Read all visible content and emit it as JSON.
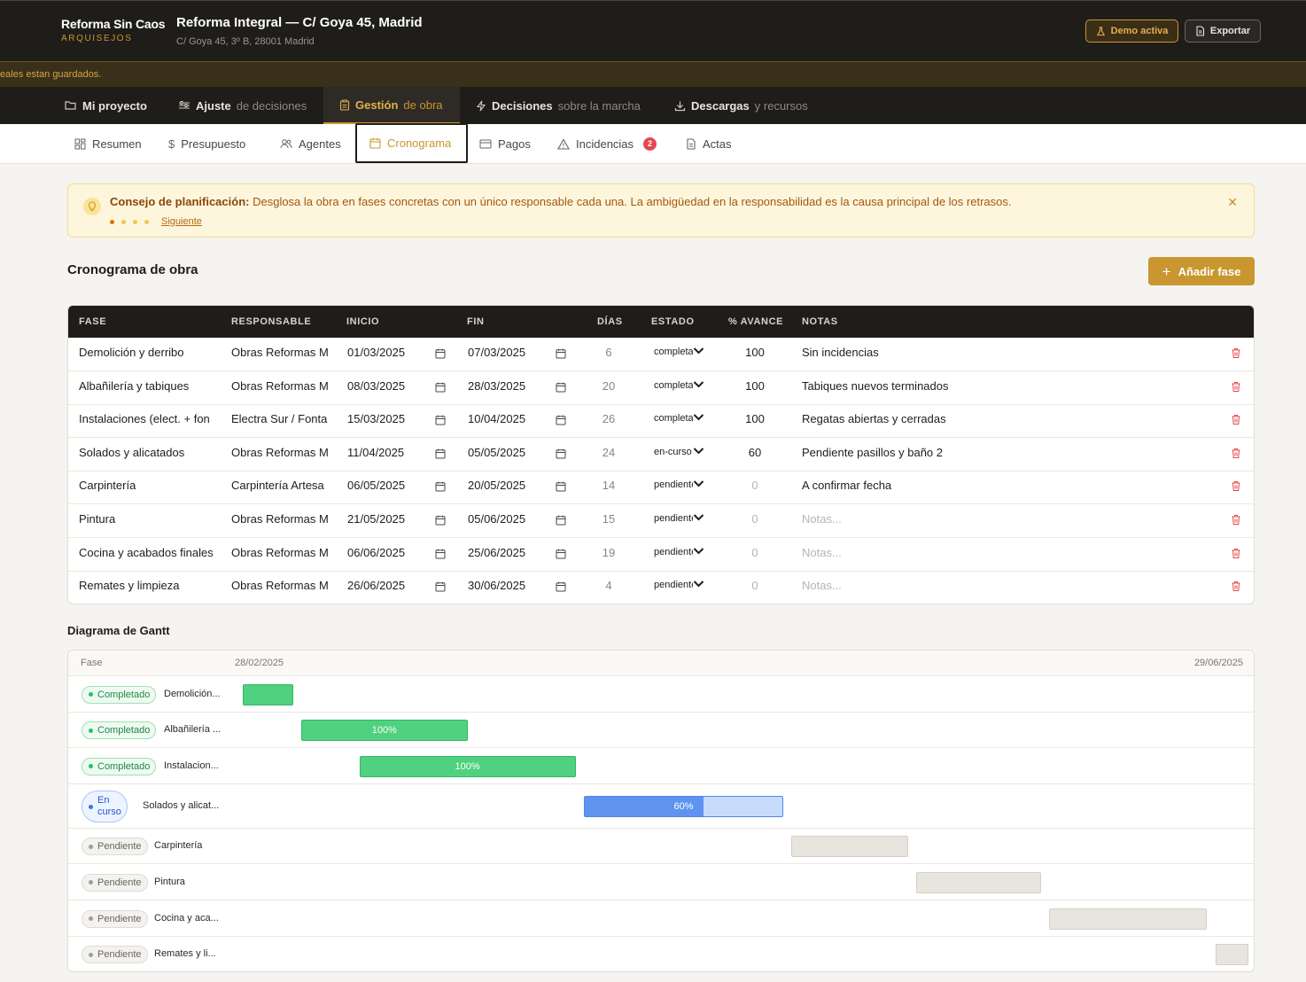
{
  "header": {
    "brand_name": "Reforma Sin Caos",
    "brand_sub": "ARQUISEJOS",
    "project_title": "Reforma Integral — C/ Goya 45, Madrid",
    "project_address": "C/ Goya 45, 3º B, 28001 Madrid",
    "demo_label": "Demo activa",
    "export_label": "Exportar"
  },
  "save_notice": "eales estan guardados.",
  "main_nav": [
    {
      "bold": "Mi proyecto",
      "light": ""
    },
    {
      "bold": "Ajuste",
      "light": "de decisiones"
    },
    {
      "bold": "Gestión",
      "light": "de obra"
    },
    {
      "bold": "Decisiones",
      "light": "sobre la marcha"
    },
    {
      "bold": "Descargas",
      "light": "y recursos"
    }
  ],
  "sub_nav": [
    {
      "label": "Resumen"
    },
    {
      "label": "Presupuesto"
    },
    {
      "label": "Agentes"
    },
    {
      "label": "Cronograma"
    },
    {
      "label": "Pagos"
    },
    {
      "label": "Incidencias",
      "badge": "2"
    },
    {
      "label": "Actas"
    }
  ],
  "tip": {
    "title": "Consejo de planificación:",
    "text": "Desglosa la obra en fases concretas con un único responsable cada una. La ambigüedad en la responsabilidad es la causa principal de los retrasos.",
    "next_label": "Siguiente"
  },
  "schedule": {
    "title": "Cronograma de obra",
    "add_label": "Añadir fase",
    "columns": [
      "FASE",
      "RESPONSABLE",
      "INICIO",
      "FIN",
      "DÍAS",
      "ESTADO",
      "% AVANCE",
      "NOTAS"
    ],
    "rows": [
      {
        "fase": "Demolición y derribo",
        "resp": "Obras Reformas M",
        "inicio": "01/03/2025",
        "fin": "07/03/2025",
        "dias": "6",
        "estado": "completado",
        "avance": "100",
        "notas": "Sin incidencias"
      },
      {
        "fase": "Albañilería y tabiques",
        "resp": "Obras Reformas M",
        "inicio": "08/03/2025",
        "fin": "28/03/2025",
        "dias": "20",
        "estado": "completado",
        "avance": "100",
        "notas": "Tabiques nuevos terminados"
      },
      {
        "fase": "Instalaciones (elect. + fon",
        "resp": "Electra Sur / Fonta",
        "inicio": "15/03/2025",
        "fin": "10/04/2025",
        "dias": "26",
        "estado": "completado",
        "avance": "100",
        "notas": "Regatas abiertas y cerradas"
      },
      {
        "fase": "Solados y alicatados",
        "resp": "Obras Reformas M",
        "inicio": "11/04/2025",
        "fin": "05/05/2025",
        "dias": "24",
        "estado": "en-curso",
        "avance": "60",
        "notas": "Pendiente pasillos y baño 2"
      },
      {
        "fase": "Carpintería",
        "resp": "Carpintería Artesa",
        "inicio": "06/05/2025",
        "fin": "20/05/2025",
        "dias": "14",
        "estado": "pendiente",
        "avance": "0",
        "notas": "A confirmar fecha"
      },
      {
        "fase": "Pintura",
        "resp": "Obras Reformas M",
        "inicio": "21/05/2025",
        "fin": "05/06/2025",
        "dias": "15",
        "estado": "pendiente",
        "avance": "0",
        "notas": ""
      },
      {
        "fase": "Cocina y acabados finales",
        "resp": "Obras Reformas M",
        "inicio": "06/06/2025",
        "fin": "25/06/2025",
        "dias": "19",
        "estado": "pendiente",
        "avance": "0",
        "notas": ""
      },
      {
        "fase": "Remates y limpieza",
        "resp": "Obras Reformas M",
        "inicio": "26/06/2025",
        "fin": "30/06/2025",
        "dias": "4",
        "estado": "pendiente",
        "avance": "0",
        "notas": ""
      }
    ],
    "notes_placeholder": "Notas..."
  },
  "gantt": {
    "title": "Diagrama de Gantt",
    "col_label": "Fase",
    "start_label": "28/02/2025",
    "end_label": "29/06/2025",
    "rows": [
      {
        "status": "Completado",
        "name": "Demolición...",
        "bar_label": "",
        "progress": 1.0
      },
      {
        "status": "Completado",
        "name": "Albañilería ...",
        "bar_label": "100%",
        "progress": 1.0
      },
      {
        "status": "Completado",
        "name": "Instalacion...",
        "bar_label": "100%",
        "progress": 1.0
      },
      {
        "status_line1": "En",
        "status_line2": "curso",
        "name": "Solados y alicat...",
        "bar_label": "60%",
        "progress": 0.6
      },
      {
        "status": "Pendiente",
        "name": "Carpintería",
        "bar_label": "",
        "progress": 0
      },
      {
        "status": "Pendiente",
        "name": "Pintura",
        "bar_label": "",
        "progress": 0
      },
      {
        "status": "Pendiente",
        "name": "Cocina y aca...",
        "bar_label": "",
        "progress": 0
      },
      {
        "status": "Pendiente",
        "name": "Remates y li...",
        "bar_label": "",
        "progress": 0
      }
    ]
  },
  "colors": {
    "accent": "#c9962f",
    "dark": "#1f1d1a",
    "done": "#4fd17f",
    "progress": "#5e94f0",
    "pending": "#e8e5de",
    "danger": "#e5484d"
  }
}
